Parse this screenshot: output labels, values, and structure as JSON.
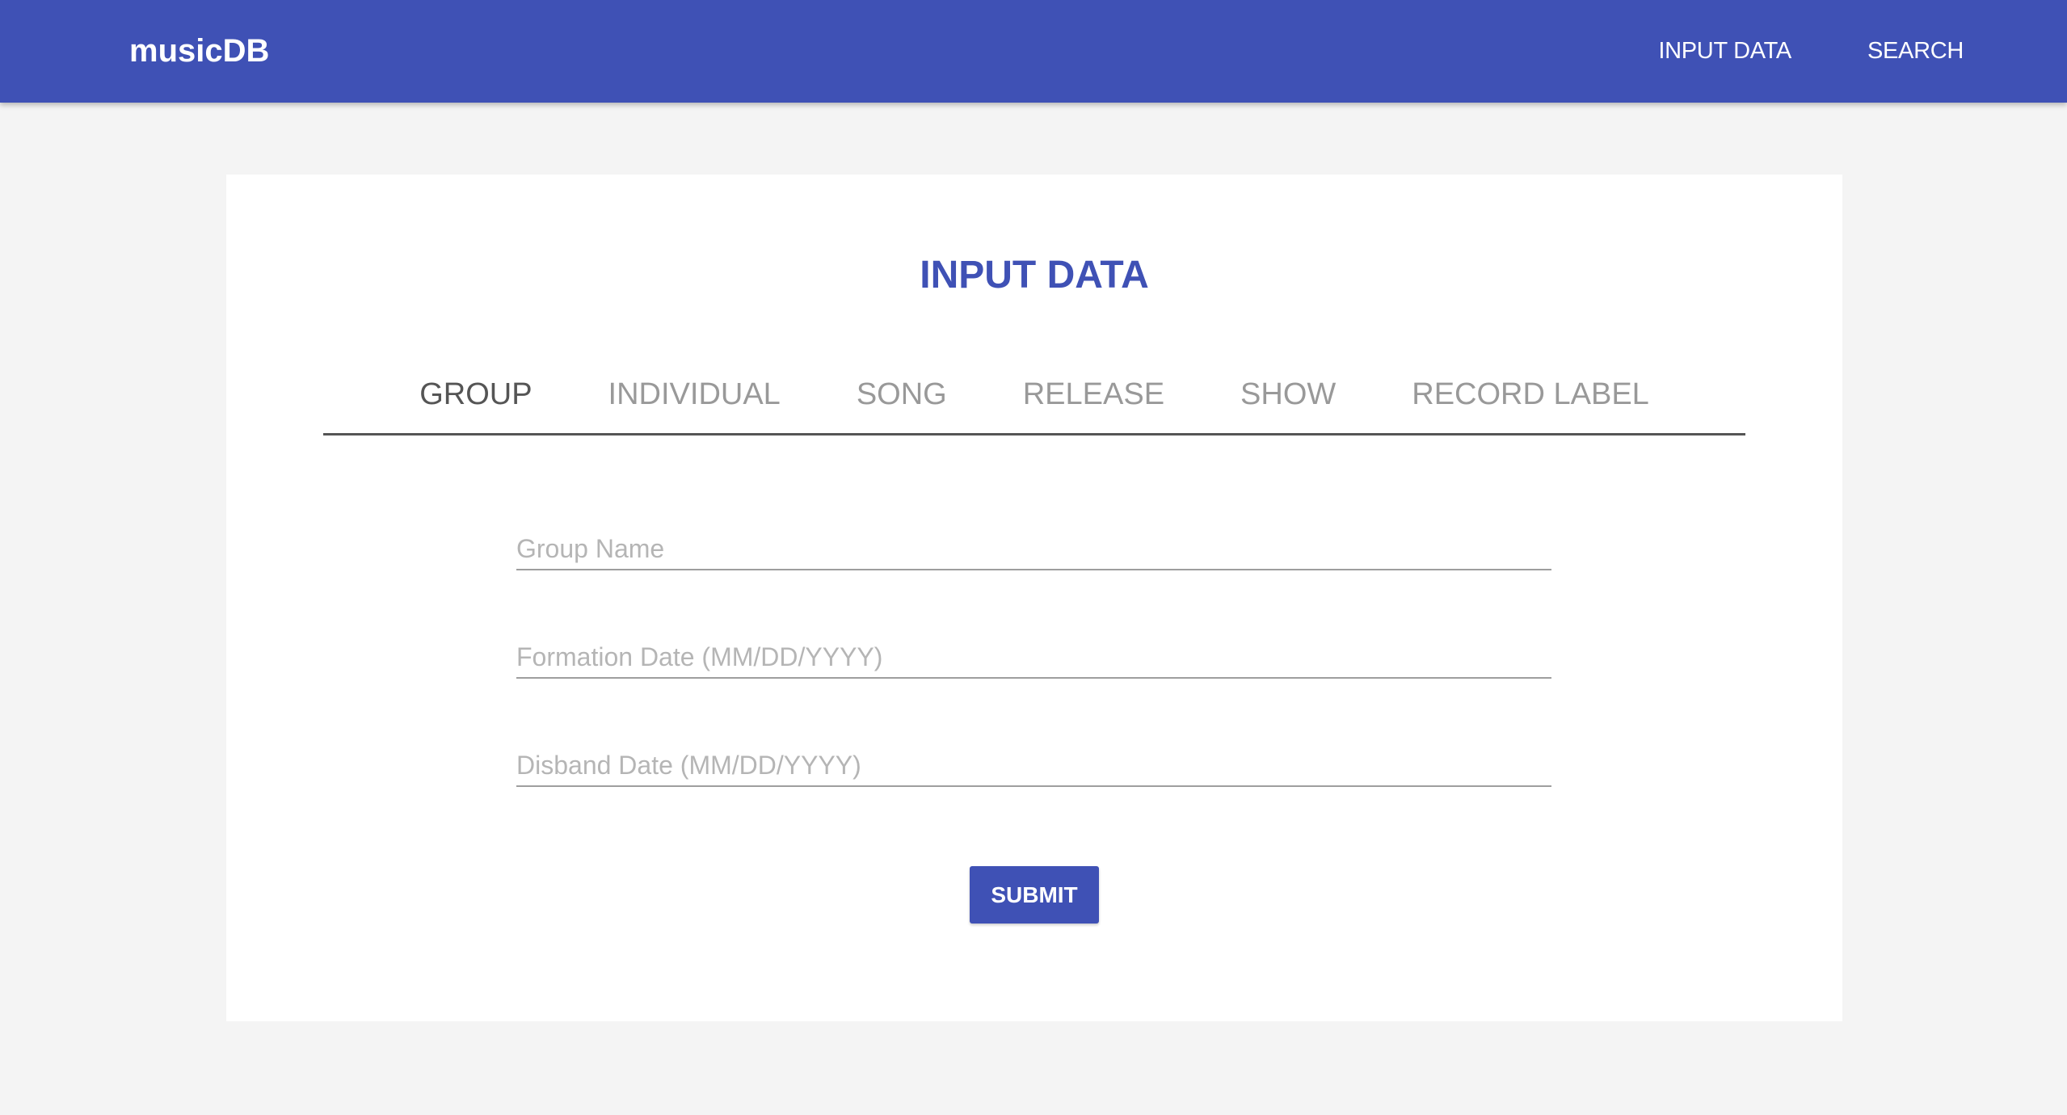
{
  "navbar": {
    "brand": "musicDB",
    "links": [
      {
        "label": "INPUT DATA"
      },
      {
        "label": "SEARCH"
      }
    ]
  },
  "main": {
    "title": "INPUT DATA",
    "tabs": [
      {
        "label": "GROUP",
        "active": true
      },
      {
        "label": "INDIVIDUAL",
        "active": false
      },
      {
        "label": "SONG",
        "active": false
      },
      {
        "label": "RELEASE",
        "active": false
      },
      {
        "label": "SHOW",
        "active": false
      },
      {
        "label": "RECORD LABEL",
        "active": false
      }
    ],
    "form": {
      "fields": [
        {
          "placeholder": "Group Name",
          "value": ""
        },
        {
          "placeholder": "Formation Date (MM/DD/YYYY)",
          "value": ""
        },
        {
          "placeholder": "Disband Date (MM/DD/YYYY)",
          "value": ""
        }
      ],
      "submit_label": "SUBMIT"
    }
  },
  "colors": {
    "primary": "#3f51b5",
    "background": "#f4f4f4",
    "card": "#ffffff",
    "tab_active": "#555555",
    "tab_inactive": "#999999"
  }
}
